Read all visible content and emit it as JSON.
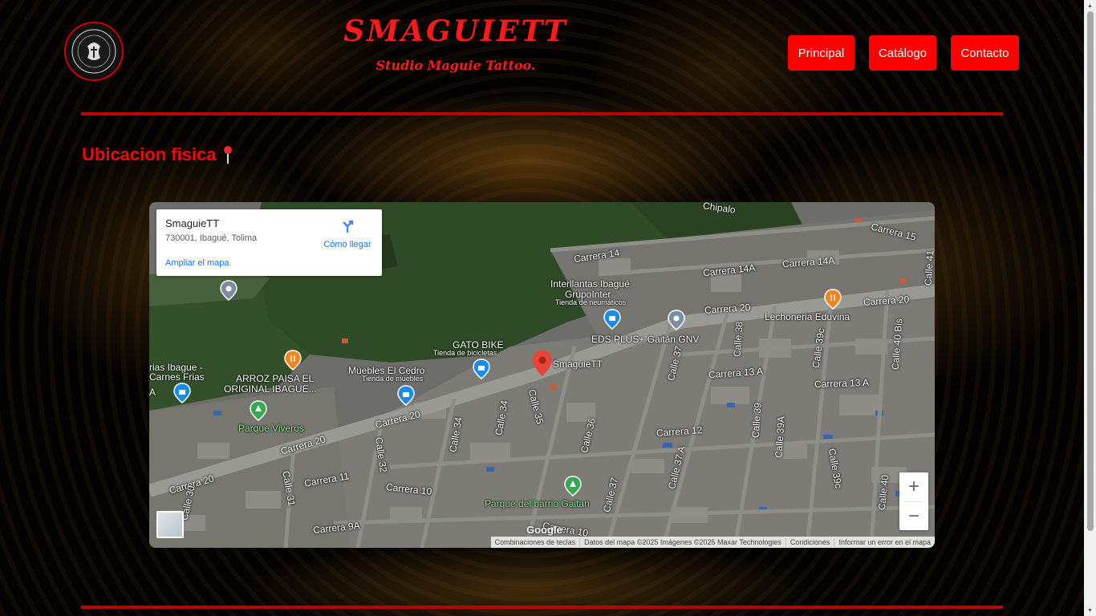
{
  "header": {
    "logo_text": "SmaguieTT",
    "brand_title": "SMAGUIETT",
    "brand_subtitle": "Studio Maguie Tattoo.",
    "nav": [
      {
        "label": "Principal"
      },
      {
        "label": "Catálogo"
      },
      {
        "label": "Contacto"
      }
    ]
  },
  "section": {
    "title": "Ubicacion fisica",
    "title_icon": "round-pushpin-icon"
  },
  "map": {
    "place_card": {
      "name": "SmaguieTT",
      "address": "730001, Ibagué, Tolima",
      "directions_label": "Cómo llegar",
      "enlarge_label": "Ampliar el mapa"
    },
    "labels": {
      "marker": "SmaguieTT",
      "interllantas_1": "Interllantas Ibagué",
      "interllantas_2": "GrupoInter",
      "interllantas_sub": "Tienda de neumáticos",
      "eds": "EDS PLUS+ Gaitán GNV",
      "gato_bike": "GATO BIKE",
      "gato_bike_sub": "Tienda de bicicletas",
      "muebles": "Muebles El Cedro",
      "muebles_sub": "Tienda de muebles",
      "arroz_1": "ARROZ PAISA EL",
      "arroz_2": "ORIGINAL IBAGUE...",
      "frias_1": "rias Ibague -",
      "frias_2": "Carnes Frias",
      "parque_viveros": "Parque Viveros",
      "parque_gaitan": "Parque del barrio Gaitan",
      "lechoneria": "Lechoneria Eduvina",
      "chipalo": "Chipalo",
      "edge_a": "A"
    },
    "streets": {
      "carrera_14": "Carrera 14",
      "carrera_14a_1": "Carrera 14A",
      "carrera_14a_2": "Carrera 14A",
      "carrera_15": "Carrera 15",
      "carrera_20_a": "Carrera 20",
      "carrera_20_b": "Carrera 20",
      "carrera_20_c": "Carrera 20",
      "carrera_20_d": "Carrera 20",
      "carrera_20_e": "Carrera 20",
      "carrera_13a_1": "Carrera 13 A",
      "carrera_13a_2": "Carrera 13 A",
      "carrera_12": "Carrera 12",
      "carrera_11": "Carrera 11",
      "carrera_10": "Carrera 10",
      "carrera_10b": "Carrera 10",
      "carrera_9a": "Carrera 9A",
      "calle_30": "Calle 30",
      "calle_31": "Calle 31",
      "calle_32": "Calle 32",
      "calle_34": "Calle 34",
      "calle_34b": "Calle 34",
      "calle_35": "Calle 35",
      "calle_36": "Calle 36",
      "calle_37": "Calle 37",
      "calle_37a": "Calle 37 A",
      "calle_37b": "Calle 37",
      "calle_38": "Calle 38",
      "calle_39": "Calle 39",
      "calle_39a": "Calle 39A",
      "calle_39c": "Calle 39c",
      "calle_39c_b": "Calle 39c",
      "calle_40": "Calle 40",
      "calle_40bis": "Calle 40 Bis",
      "calle_41": "Calle 41"
    },
    "zoom_in": "+",
    "zoom_out": "−",
    "google": "Google",
    "attribution": {
      "keyboard": "Combinaciones de teclas",
      "data": "Datos del mapa ©2025 Imágenes ©2025 Maxar Technologies",
      "terms": "Condiciones",
      "report": "Informar un error en el mapa"
    }
  },
  "colors": {
    "accent": "#ff0000",
    "rule": "#c00000",
    "link": "#1a73e8"
  }
}
